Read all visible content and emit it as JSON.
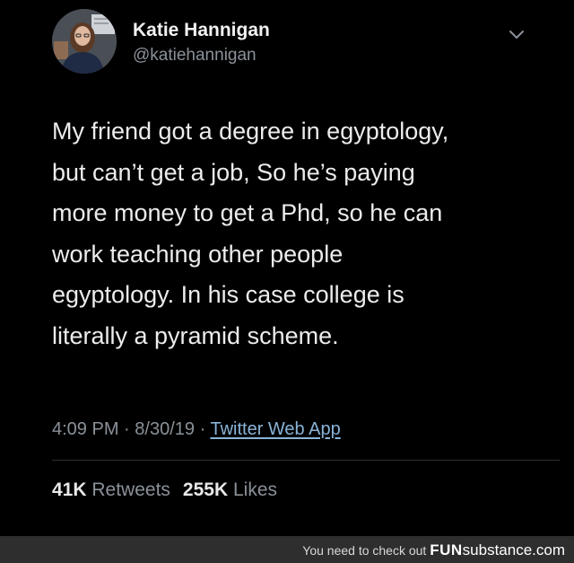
{
  "tweet": {
    "display_name": "Katie Hannigan",
    "handle": "@katiehannigan",
    "text_lines": [
      "My friend got a degree in egyptology,",
      "but can’t get a job, So he’s paying",
      "more money to get a Phd, so he can",
      "work teaching other people",
      "egyptology.  In his case college is",
      "literally a pyramid scheme."
    ],
    "time": "4:09 PM",
    "date": "8/30/19",
    "separator": "·",
    "source": "Twitter Web App",
    "retweets_count": "41K",
    "retweets_label": "Retweets",
    "likes_count": "255K",
    "likes_label": "Likes",
    "menu_icon": "chevron-down-icon",
    "avatar_icon": "avatar"
  },
  "watermark": {
    "prefix": "You need to check out",
    "brand_bold": "FUN",
    "brand_rest": "substance",
    "brand_suffix": ".com"
  },
  "colors": {
    "background": "#000000",
    "text": "#ececec",
    "secondary": "#8a9199",
    "link": "#8ab4d8",
    "watermark_bar": "#2e2e2e"
  }
}
